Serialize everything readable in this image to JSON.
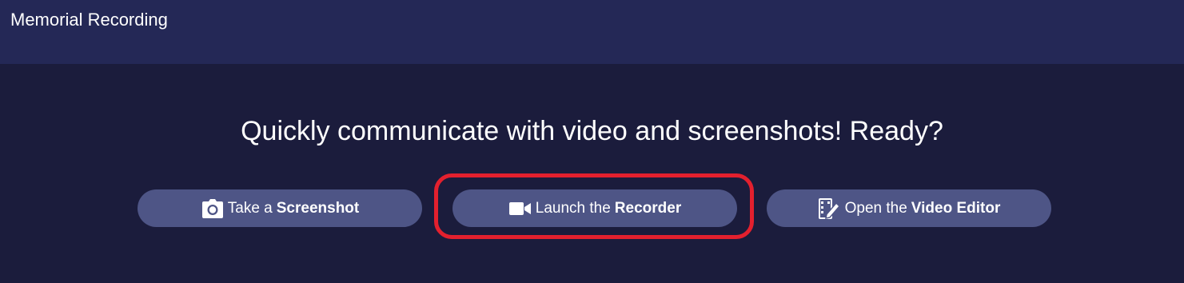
{
  "header": {
    "title": "Memorial Recording"
  },
  "main": {
    "headline": "Quickly communicate with video and screenshots! Ready?",
    "buttons": [
      {
        "icon": "camera-icon",
        "label_pre": "Take a",
        "label_bold": "Screenshot"
      },
      {
        "icon": "video-camera-icon",
        "label_pre": "Launch the",
        "label_bold": "Recorder"
      },
      {
        "icon": "video-editor-icon",
        "label_pre": "Open the",
        "label_bold": "Video Editor"
      }
    ]
  },
  "colors": {
    "header_bg": "#242856",
    "page_bg": "#1b1c3c",
    "button_bg": "#4e5586",
    "highlight": "#e3202e",
    "text": "#ffffff"
  }
}
